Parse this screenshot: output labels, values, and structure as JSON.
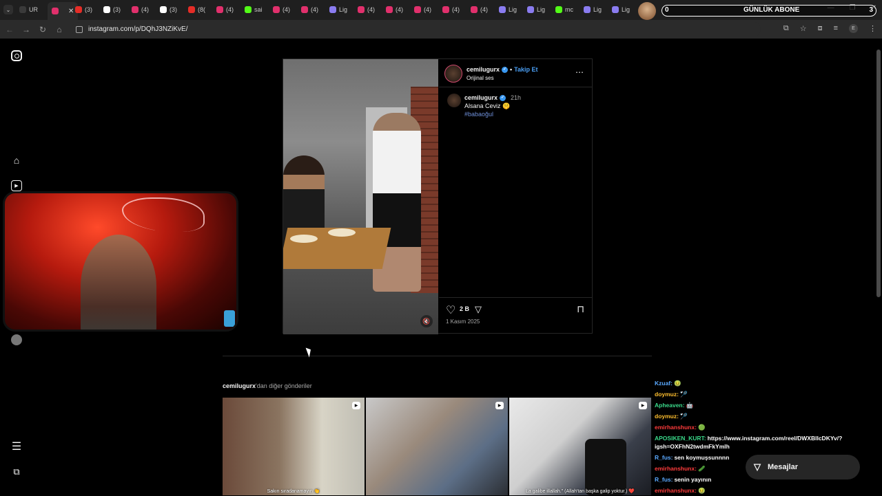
{
  "browser": {
    "tabs": [
      {
        "label": "UR",
        "color": "#3a3a3a"
      },
      {
        "label": "",
        "color": "#e1306c",
        "active": true
      },
      {
        "label": "(3)",
        "color": "#e52d27"
      },
      {
        "label": "(3)",
        "color": "#ffffff"
      },
      {
        "label": "(4)",
        "color": "#e1306c"
      },
      {
        "label": "(3)",
        "color": "#ffffff"
      },
      {
        "label": "(8(",
        "color": "#e52d27"
      },
      {
        "label": "(4)",
        "color": "#e1306c"
      },
      {
        "label": "sai",
        "color": "#53fc18"
      },
      {
        "label": "(4)",
        "color": "#e1306c"
      },
      {
        "label": "(4)",
        "color": "#e1306c"
      },
      {
        "label": "Lig",
        "color": "#8a7cf0"
      },
      {
        "label": "(4)",
        "color": "#e1306c"
      },
      {
        "label": "(4)",
        "color": "#e1306c"
      },
      {
        "label": "(4)",
        "color": "#e1306c"
      },
      {
        "label": "(4)",
        "color": "#e1306c"
      },
      {
        "label": "(4)",
        "color": "#e1306c"
      },
      {
        "label": "Lig",
        "color": "#8a7cf0"
      },
      {
        "label": "Lig",
        "color": "#8a7cf0"
      },
      {
        "label": "mc",
        "color": "#53fc18"
      },
      {
        "label": "Lig",
        "color": "#8a7cf0"
      },
      {
        "label": "Lig",
        "color": "#8a7cf0"
      }
    ],
    "active_tab_close": "✕",
    "url": "instagram.com/p/DQhJ3NZiKvE/"
  },
  "stream_overlay": {
    "sub_left": "0",
    "sub_label": "GÜNLÜK ABONE",
    "sub_right": "3"
  },
  "post": {
    "username": "cemilugurx",
    "follow": "Takip Et",
    "separator": "•",
    "audio": "Orijinal ses",
    "caption_time": "21h",
    "caption_text": "Alsana Ceviz 🤫",
    "hashtag": "#babaoğul",
    "likes": "2 B",
    "date": "1 Kasım 2025"
  },
  "more_posts": {
    "username": "cemilugurx",
    "suffix": "'dan diğer gönderiler",
    "thumbs": [
      {
        "caption": "Sakın sıradanamayın 👏"
      },
      {
        "caption": ""
      },
      {
        "caption": "La galibe illallah.\" (Allah'tan başka galip yoktur.) ❤️"
      }
    ]
  },
  "chat": [
    {
      "user": "Kzuaf:",
      "color": "#5aa9ff",
      "msg": "🤢"
    },
    {
      "user": "doymuz:",
      "color": "#ffbf2e",
      "msg": "🏸"
    },
    {
      "user": "Apheaven:",
      "color": "#3ad98a",
      "msg": "🤖"
    },
    {
      "user": "doymuz:",
      "color": "#ffbf2e",
      "msg": "🏸"
    },
    {
      "user": "emirhanshunx:",
      "color": "#ff3b3b",
      "msg": "🟢"
    },
    {
      "user": "APOSIKEN_KURT:",
      "color": "#3ad98a",
      "msg": "https://www.instagram.com/reel/DWXBlIcDKYv/?igsh=OXFhN2twdmFkYmlh"
    },
    {
      "user": "R_fus:",
      "color": "#5aa9ff",
      "msg": "sen koymuşsunnnn"
    },
    {
      "user": "emirhanshunx:",
      "color": "#ff3b3b",
      "msg": "🥒"
    },
    {
      "user": "R_fus:",
      "color": "#5aa9ff",
      "msg": "senin yayının"
    },
    {
      "user": "emirhanshunx:",
      "color": "#ff3b3b",
      "msg": "🤢"
    }
  ],
  "messages_button": "Mesajlar",
  "icons": {
    "back": "←",
    "forward": "→",
    "reload": "↻",
    "home": "⌂",
    "more": "⋯",
    "heart": "♡",
    "share": "▽",
    "save": "⊓",
    "mute": "🔇",
    "menu": "☰",
    "grid": "⧉",
    "reel": "▶"
  }
}
